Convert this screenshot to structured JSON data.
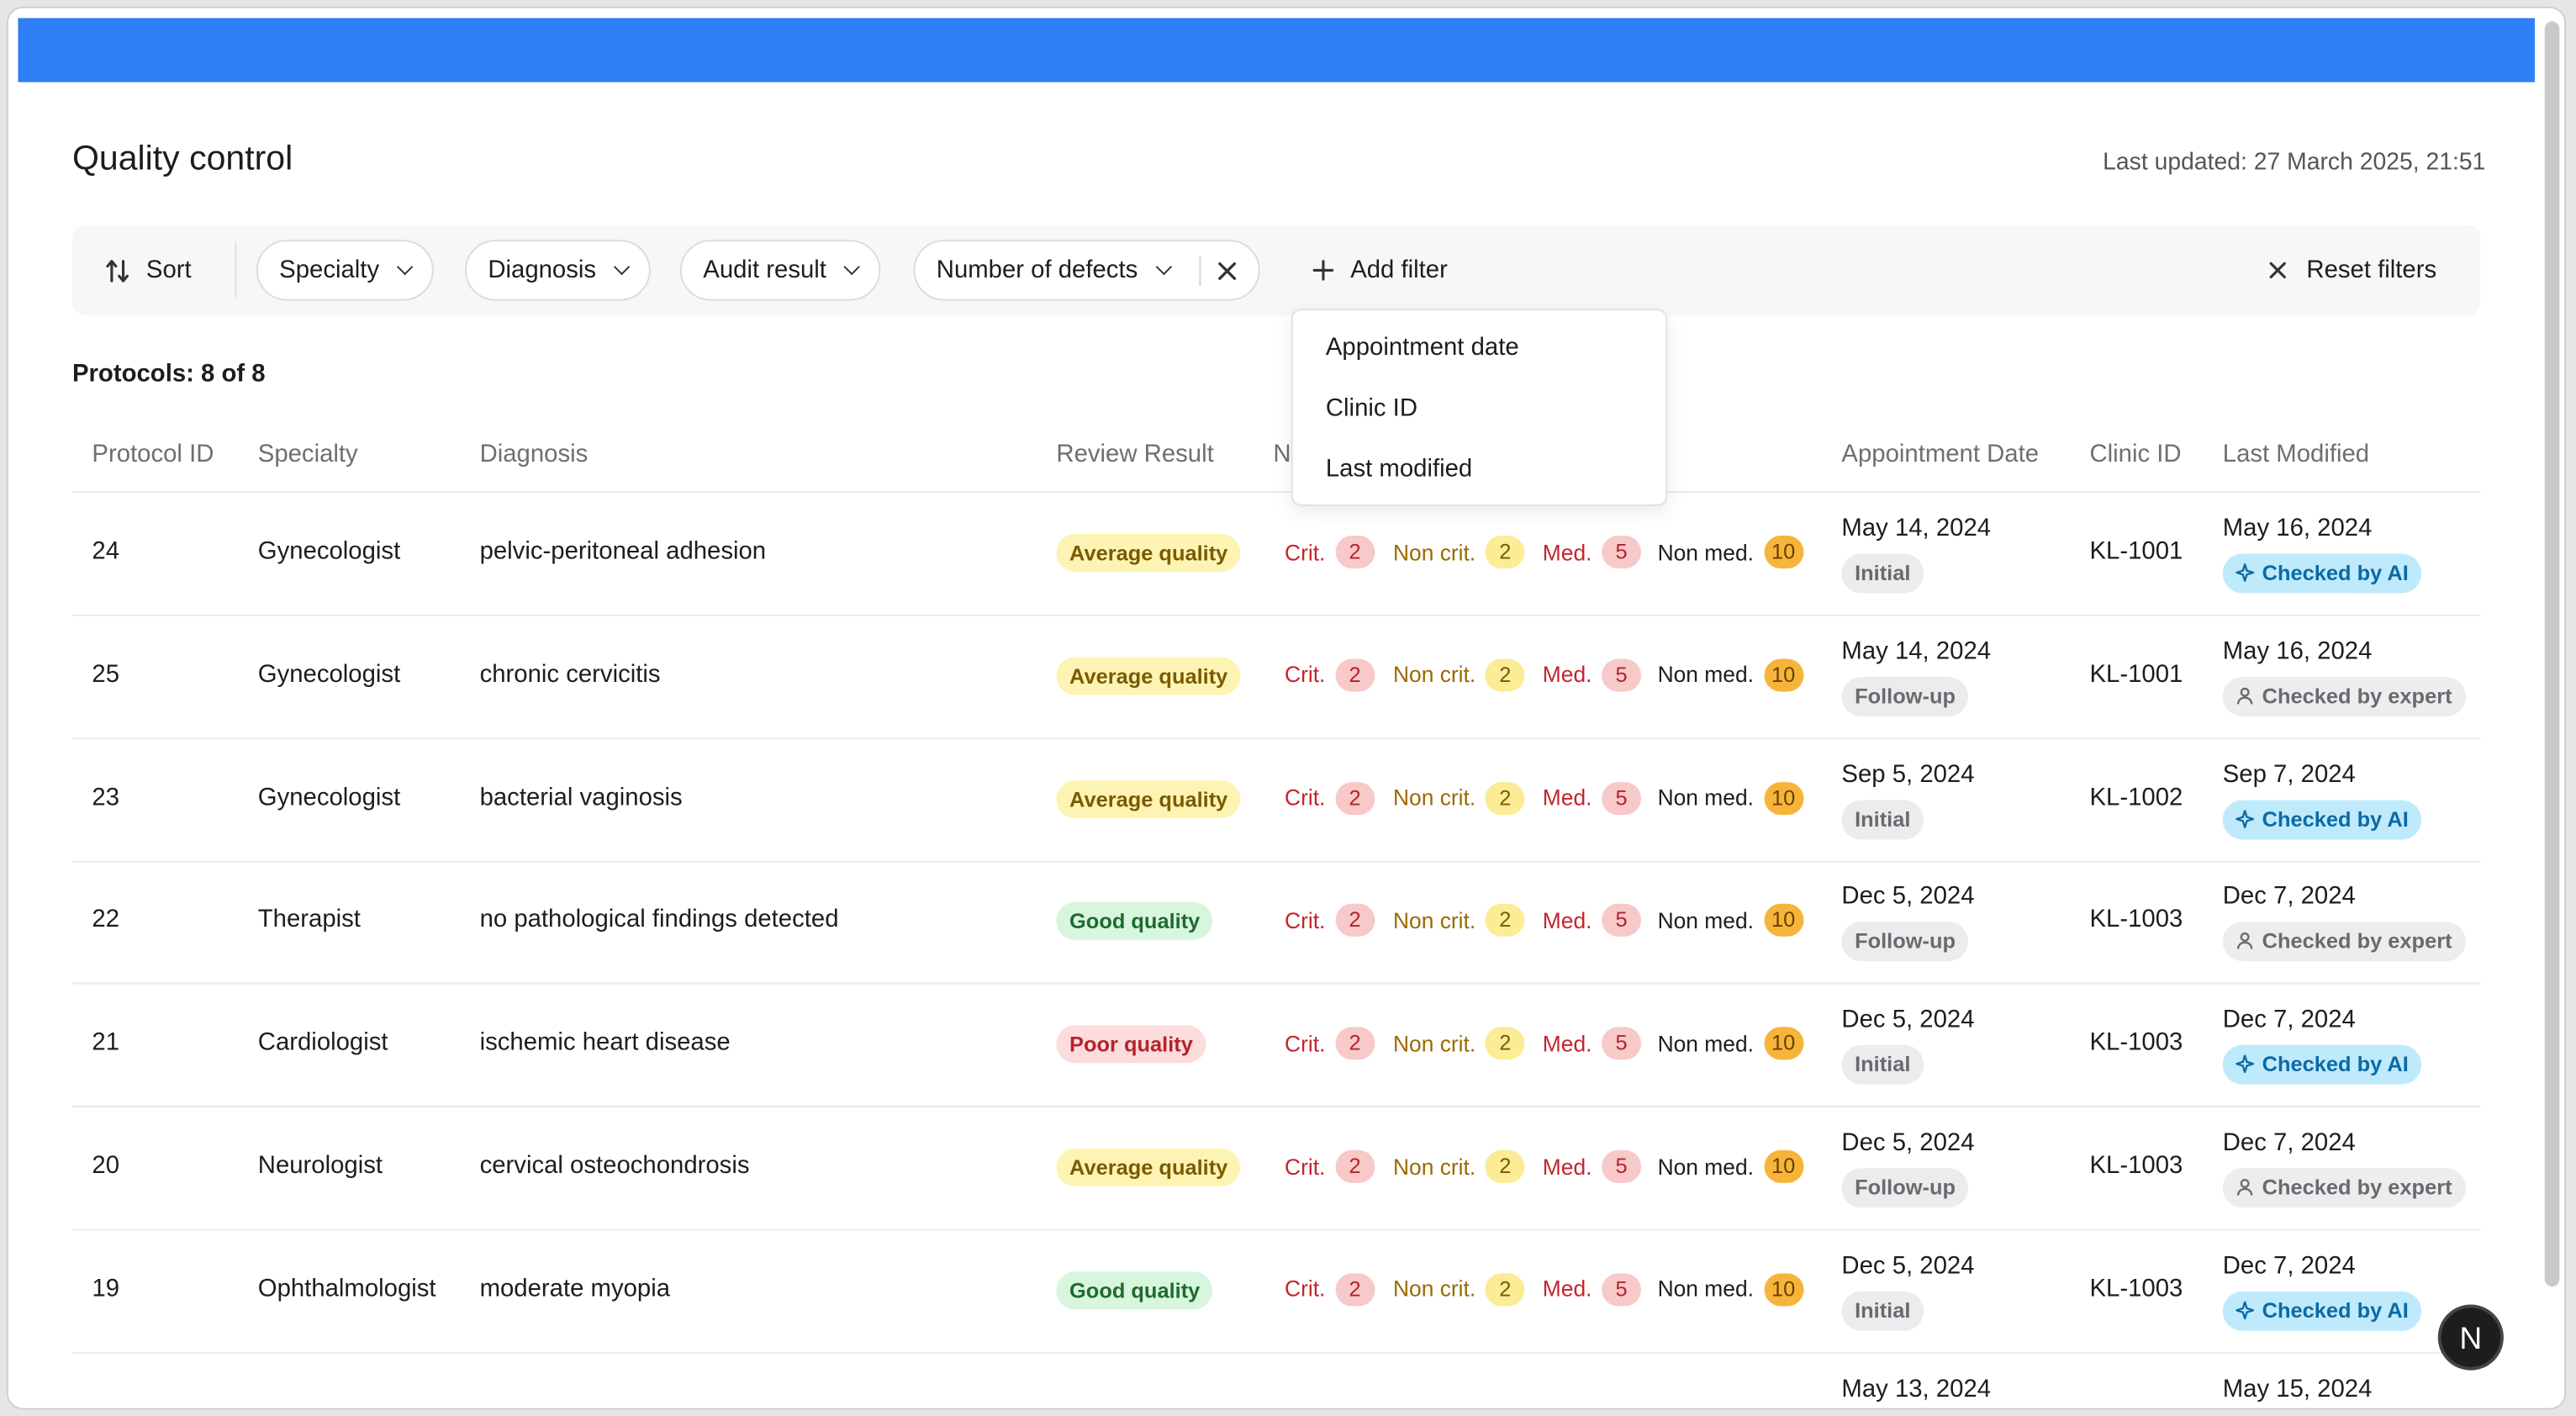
{
  "header": {
    "title": "Quality control",
    "last_updated": "Last updated: 27 March 2025, 21:51"
  },
  "filters": {
    "sort_label": "Sort",
    "chips": [
      "Specialty",
      "Diagnosis",
      "Audit result",
      "Number of defects"
    ],
    "add_filter": "Add filter",
    "reset": "Reset filters",
    "dropdown": [
      "Appointment date",
      "Clinic ID",
      "Last modified"
    ]
  },
  "protocols_count": "Protocols: 8 of 8",
  "columns": [
    "Protocol ID",
    "Specialty",
    "Diagnosis",
    "Review Result",
    "N",
    "Appointment Date",
    "Clinic ID",
    "Last Modified"
  ],
  "defect_labels": {
    "crit": "Crit.",
    "noncrit": "Non crit.",
    "med": "Med.",
    "nonmed": "Non med."
  },
  "colors": {
    "primary": "#2f7ff7"
  },
  "rows": [
    {
      "id": "24",
      "specialty": "Gynecologist",
      "diagnosis": "pelvic-peritoneal adhesion",
      "result": "Average quality",
      "result_type": "avg",
      "crit": "2",
      "noncrit": "2",
      "med": "5",
      "nonmed": "10",
      "appt_date": "May 14, 2024",
      "appt_type": "Initial",
      "clinic": "KL-1001",
      "modified": "May 16, 2024",
      "check": "Checked by AI",
      "check_type": "ai"
    },
    {
      "id": "25",
      "specialty": "Gynecologist",
      "diagnosis": "chronic cervicitis",
      "result": "Average quality",
      "result_type": "avg",
      "crit": "2",
      "noncrit": "2",
      "med": "5",
      "nonmed": "10",
      "appt_date": "May 14, 2024",
      "appt_type": "Follow-up",
      "clinic": "KL-1001",
      "modified": "May 16, 2024",
      "check": "Checked by expert",
      "check_type": "expert"
    },
    {
      "id": "23",
      "specialty": "Gynecologist",
      "diagnosis": "bacterial vaginosis",
      "result": "Average quality",
      "result_type": "avg",
      "crit": "2",
      "noncrit": "2",
      "med": "5",
      "nonmed": "10",
      "appt_date": "Sep 5, 2024",
      "appt_type": "Initial",
      "clinic": "KL-1002",
      "modified": "Sep 7, 2024",
      "check": "Checked by AI",
      "check_type": "ai"
    },
    {
      "id": "22",
      "specialty": "Therapist",
      "diagnosis": "no pathological findings detected",
      "result": "Good quality",
      "result_type": "good",
      "crit": "2",
      "noncrit": "2",
      "med": "5",
      "nonmed": "10",
      "appt_date": "Dec 5, 2024",
      "appt_type": "Follow-up",
      "clinic": "KL-1003",
      "modified": "Dec 7, 2024",
      "check": "Checked by expert",
      "check_type": "expert"
    },
    {
      "id": "21",
      "specialty": "Cardiologist",
      "diagnosis": "ischemic heart disease",
      "result": "Poor quality",
      "result_type": "poor",
      "crit": "2",
      "noncrit": "2",
      "med": "5",
      "nonmed": "10",
      "appt_date": "Dec 5, 2024",
      "appt_type": "Initial",
      "clinic": "KL-1003",
      "modified": "Dec 7, 2024",
      "check": "Checked by AI",
      "check_type": "ai"
    },
    {
      "id": "20",
      "specialty": "Neurologist",
      "diagnosis": "cervical osteochondrosis",
      "result": "Average quality",
      "result_type": "avg",
      "crit": "2",
      "noncrit": "2",
      "med": "5",
      "nonmed": "10",
      "appt_date": "Dec 5, 2024",
      "appt_type": "Follow-up",
      "clinic": "KL-1003",
      "modified": "Dec 7, 2024",
      "check": "Checked by expert",
      "check_type": "expert"
    },
    {
      "id": "19",
      "specialty": "Ophthalmologist",
      "diagnosis": "moderate myopia",
      "result": "Good quality",
      "result_type": "good",
      "crit": "2",
      "noncrit": "2",
      "med": "5",
      "nonmed": "10",
      "appt_date": "Dec 5, 2024",
      "appt_type": "Initial",
      "clinic": "KL-1003",
      "modified": "Dec 7, 2024",
      "check": "Checked by AI",
      "check_type": "ai"
    },
    {
      "id": "",
      "specialty": "",
      "diagnosis": "",
      "result": "",
      "result_type": "avg",
      "crit": "",
      "noncrit": "",
      "med": "",
      "nonmed": "",
      "appt_date": "May 13, 2024",
      "appt_type": "",
      "clinic": "",
      "modified": "May 15, 2024",
      "check": "",
      "check_type": "ai"
    }
  ],
  "avatar_letter": "N"
}
